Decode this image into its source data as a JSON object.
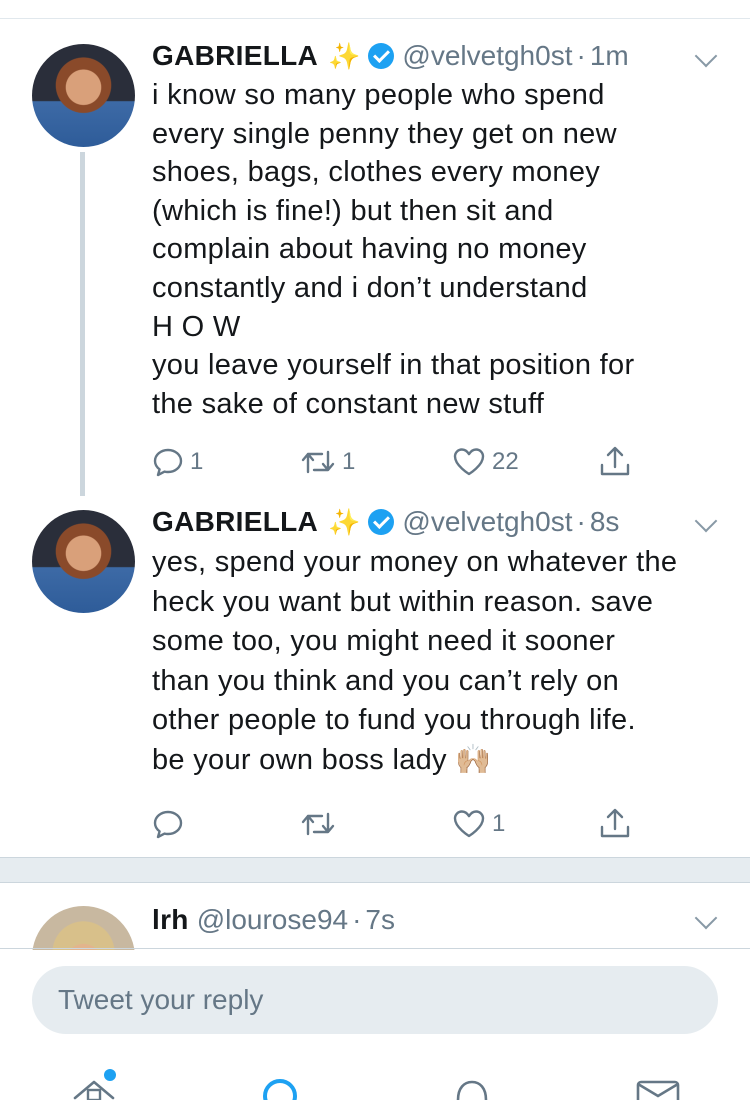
{
  "tweets": [
    {
      "name": "GABRIELLA",
      "sparkle": "✨",
      "handle": "@velvetgh0st",
      "separator": "·",
      "time": "1m",
      "text": "i know so many people who spend\nevery single penny they get on new\nshoes, bags, clothes every money\n(which is fine!) but then sit and\ncomplain about having no money\nconstantly and i don’t understand\nH O W\nyou leave yourself in that position for\nthe sake of constant new stuff",
      "reply_count": "1",
      "retweet_count": "1",
      "like_count": "22"
    },
    {
      "name": "GABRIELLA",
      "sparkle": "✨",
      "handle": "@velvetgh0st",
      "separator": "·",
      "time": "8s",
      "text": "yes, spend your money on whatever the\nheck you want but within reason. save\nsome too, you might need it sooner\nthan you think and you can’t rely on\nother people to fund you through life.\nbe your own boss lady 🙌🏼",
      "reply_count": "",
      "retweet_count": "",
      "like_count": "1"
    },
    {
      "name": "lrh",
      "handle": "@lourose94",
      "separator": "·",
      "time": "7s"
    }
  ],
  "reply": {
    "placeholder": "Tweet your reply"
  },
  "icons": {
    "reply": "reply-icon",
    "retweet": "retweet-icon",
    "like": "heart-icon",
    "share": "share-icon",
    "verified": "verified-badge-icon",
    "more": "chevron-down-icon",
    "tabs": [
      "home-icon",
      "search-icon",
      "notifications-icon",
      "messages-icon"
    ]
  },
  "colors": {
    "accent": "#1da1f2",
    "secondary_text": "#657786",
    "divider": "#e6ecf0"
  }
}
